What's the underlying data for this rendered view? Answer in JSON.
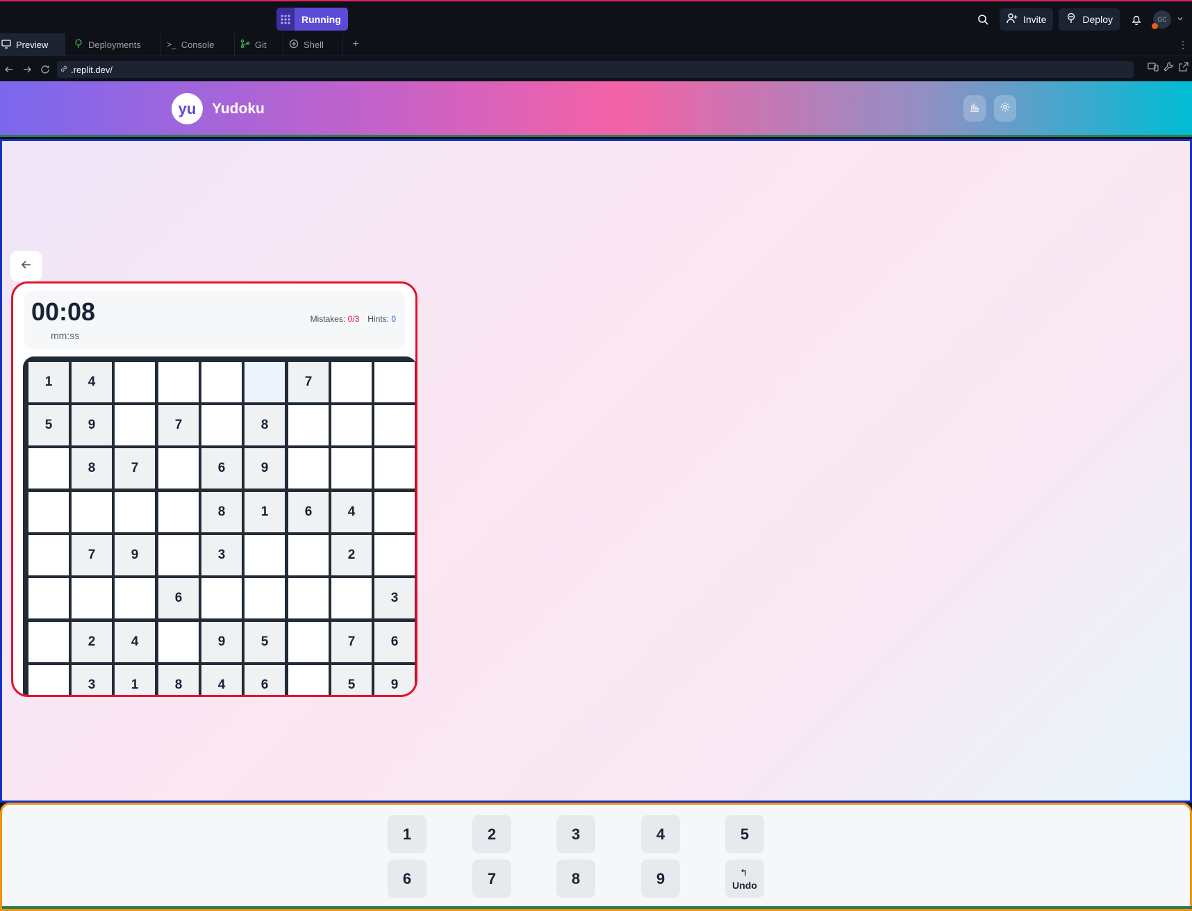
{
  "replit": {
    "run_status": "Running",
    "invite_label": "Invite",
    "deploy_label": "Deploy",
    "avatar_initials": "GC",
    "tabs": [
      {
        "label": "Preview"
      },
      {
        "label": "Deployments"
      },
      {
        "label": "Console"
      },
      {
        "label": "Git"
      },
      {
        "label": "Shell"
      }
    ],
    "add_tab": "+",
    "url": ".replit.dev/"
  },
  "app": {
    "logo_text": "yu",
    "title": "Yudoku"
  },
  "game": {
    "timer": "00:08",
    "timer_unit": "mm:ss",
    "mistakes_label": "Mistakes:",
    "mistakes_value": "0/3",
    "hints_label": "Hints:",
    "hints_value": "0",
    "board": [
      [
        "1",
        "4",
        "",
        "",
        "",
        "",
        "7",
        "",
        ""
      ],
      [
        "5",
        "9",
        "",
        "7",
        "",
        "8",
        "",
        "",
        ""
      ],
      [
        "",
        "8",
        "7",
        "",
        "6",
        "9",
        "",
        "",
        ""
      ],
      [
        "",
        "",
        "",
        "",
        "8",
        "1",
        "6",
        "4",
        ""
      ],
      [
        "",
        "7",
        "9",
        "",
        "3",
        "",
        "",
        "2",
        ""
      ],
      [
        "",
        "",
        "",
        "6",
        "",
        "",
        "",
        "",
        "3"
      ],
      [
        "",
        "2",
        "4",
        "",
        "9",
        "5",
        "",
        "7",
        "6"
      ],
      [
        "",
        "3",
        "1",
        "8",
        "4",
        "6",
        "",
        "5",
        "9"
      ]
    ],
    "selected_cell": [
      0,
      5
    ]
  },
  "keypad": {
    "keys": [
      "1",
      "2",
      "3",
      "4",
      "5",
      "6",
      "7",
      "8",
      "9"
    ],
    "undo_label": "Undo"
  },
  "colors": {
    "accent": "#5b4bd6",
    "mistakes": "#e3132d",
    "hints": "#2456e8"
  }
}
